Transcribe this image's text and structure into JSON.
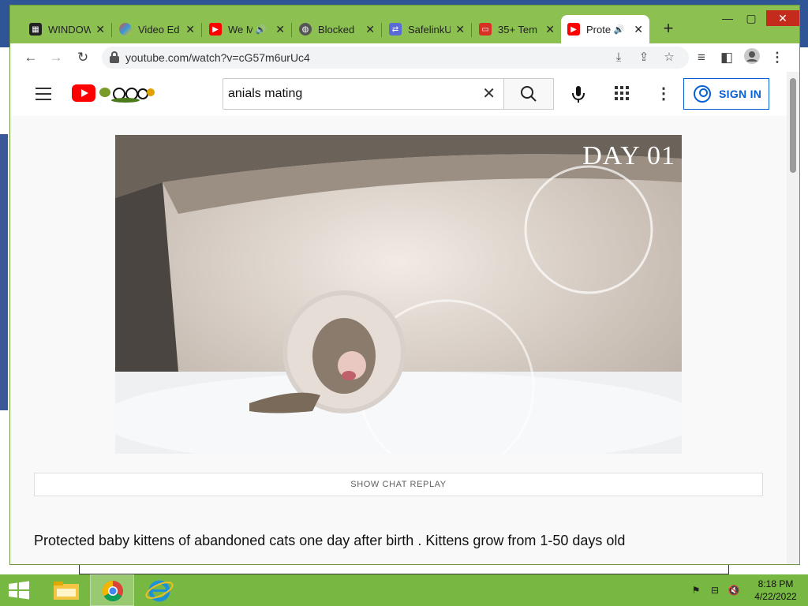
{
  "tabs": [
    {
      "title": "WINDOW",
      "icon": "film-icon",
      "audio": false
    },
    {
      "title": "Video Ed",
      "icon": "palette-icon",
      "audio": false
    },
    {
      "title": "We M",
      "icon": "youtube-icon",
      "audio": true
    },
    {
      "title": "Blocked",
      "icon": "globe-icon",
      "audio": false
    },
    {
      "title": "SafelinkU",
      "icon": "link-icon",
      "audio": false
    },
    {
      "title": "35+ Tem",
      "icon": "slides-icon",
      "audio": false
    },
    {
      "title": "Prote",
      "icon": "youtube-icon",
      "audio": true
    }
  ],
  "toolbar": {
    "url": "youtube.com/watch?v=cG57m6urUc4"
  },
  "youtube": {
    "search": {
      "value": "anials mating"
    },
    "sign_in_label": "SIGN IN"
  },
  "video": {
    "overlay_text": "DAY 01"
  },
  "chat_replay_label": "SHOW CHAT REPLAY",
  "video_title": "Protected baby kittens of abandoned cats one day after birth . Kittens grow from 1-50 days old",
  "taskbar": {
    "time": "8:18 PM",
    "date": "4/22/2022"
  },
  "colors": {
    "window_frame": "#8cc151",
    "taskbar": "#77b843",
    "youtube_red": "#ff0000",
    "sign_in_blue": "#065fd4",
    "close_red": "#c42b1c"
  }
}
